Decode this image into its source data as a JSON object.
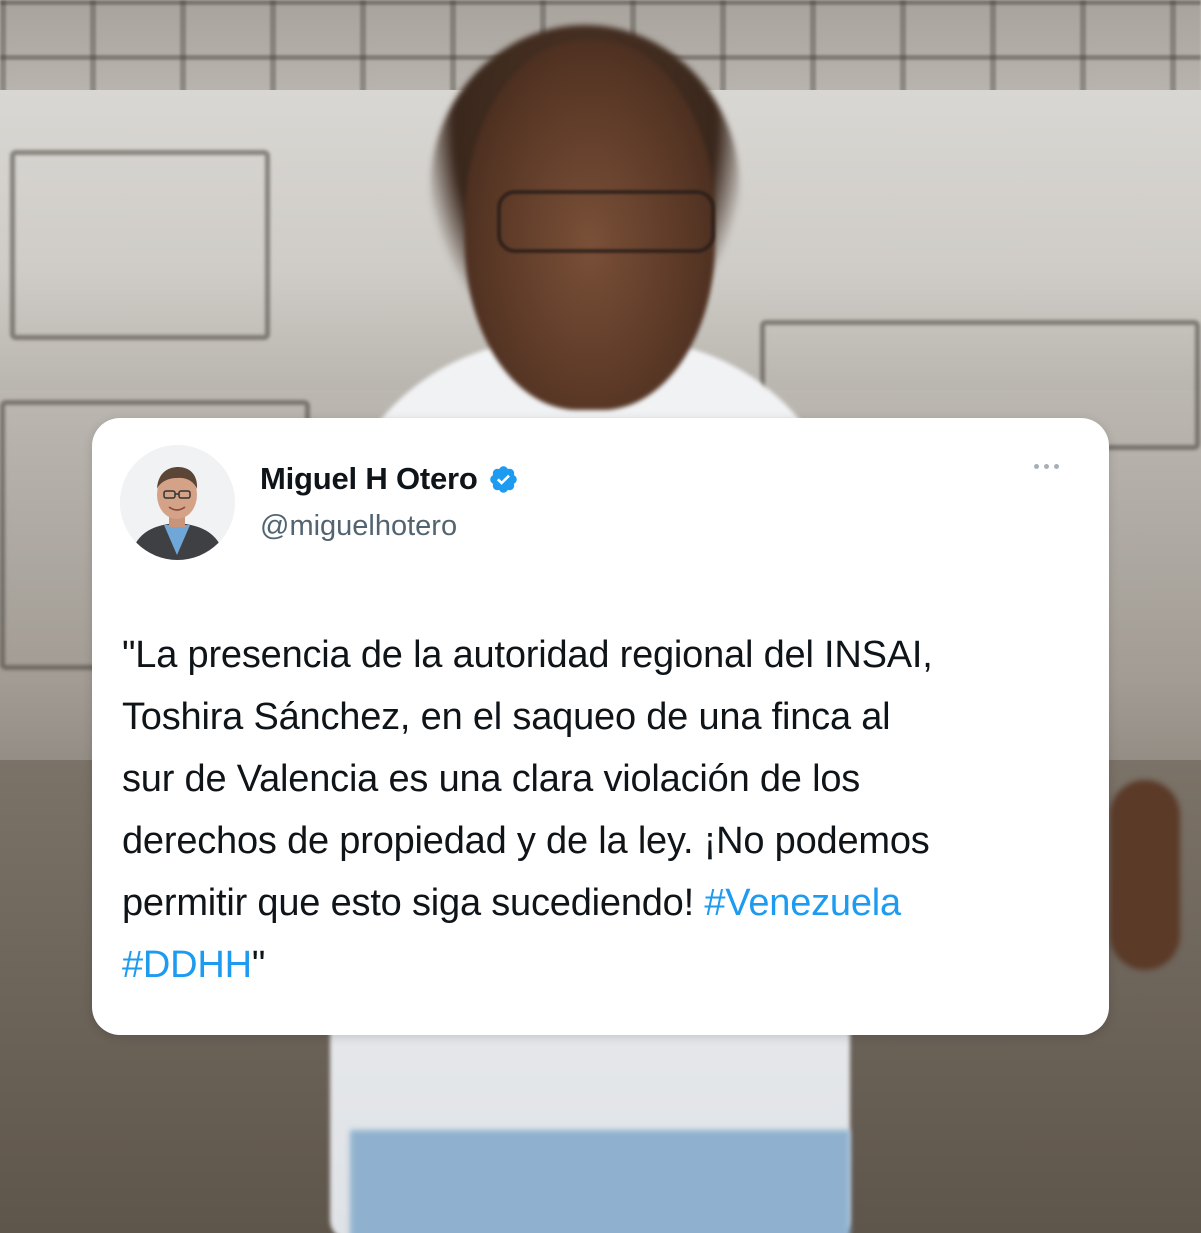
{
  "tweet": {
    "author_name": "Miguel H Otero",
    "author_handle": "@miguelhotero",
    "verified": true,
    "text_lines": {
      "line1": "\"La presencia de la autoridad regional del INSAI,",
      "line2": "Toshira Sánchez, en el saqueo de una finca al",
      "line3": "sur de Valencia es una clara violación de los",
      "line4": "derechos de propiedad y de la ley. ¡No podemos",
      "line5_text": "permitir que esto siga sucediendo! ",
      "line5_hashtag": "#Venezuela",
      "line6_hashtag": "#DDHH",
      "line6_text": "\""
    },
    "hashtags": [
      "#Venezuela",
      "#DDHH"
    ],
    "more_icon": "more-horizontal-icon",
    "badge_icon": "verified-badge-icon"
  },
  "colors": {
    "card_background": "#ffffff",
    "text_primary": "#0f1419",
    "text_secondary": "#536471",
    "hashtag": "#1d9bf0",
    "verified": "#1d9bf0"
  }
}
